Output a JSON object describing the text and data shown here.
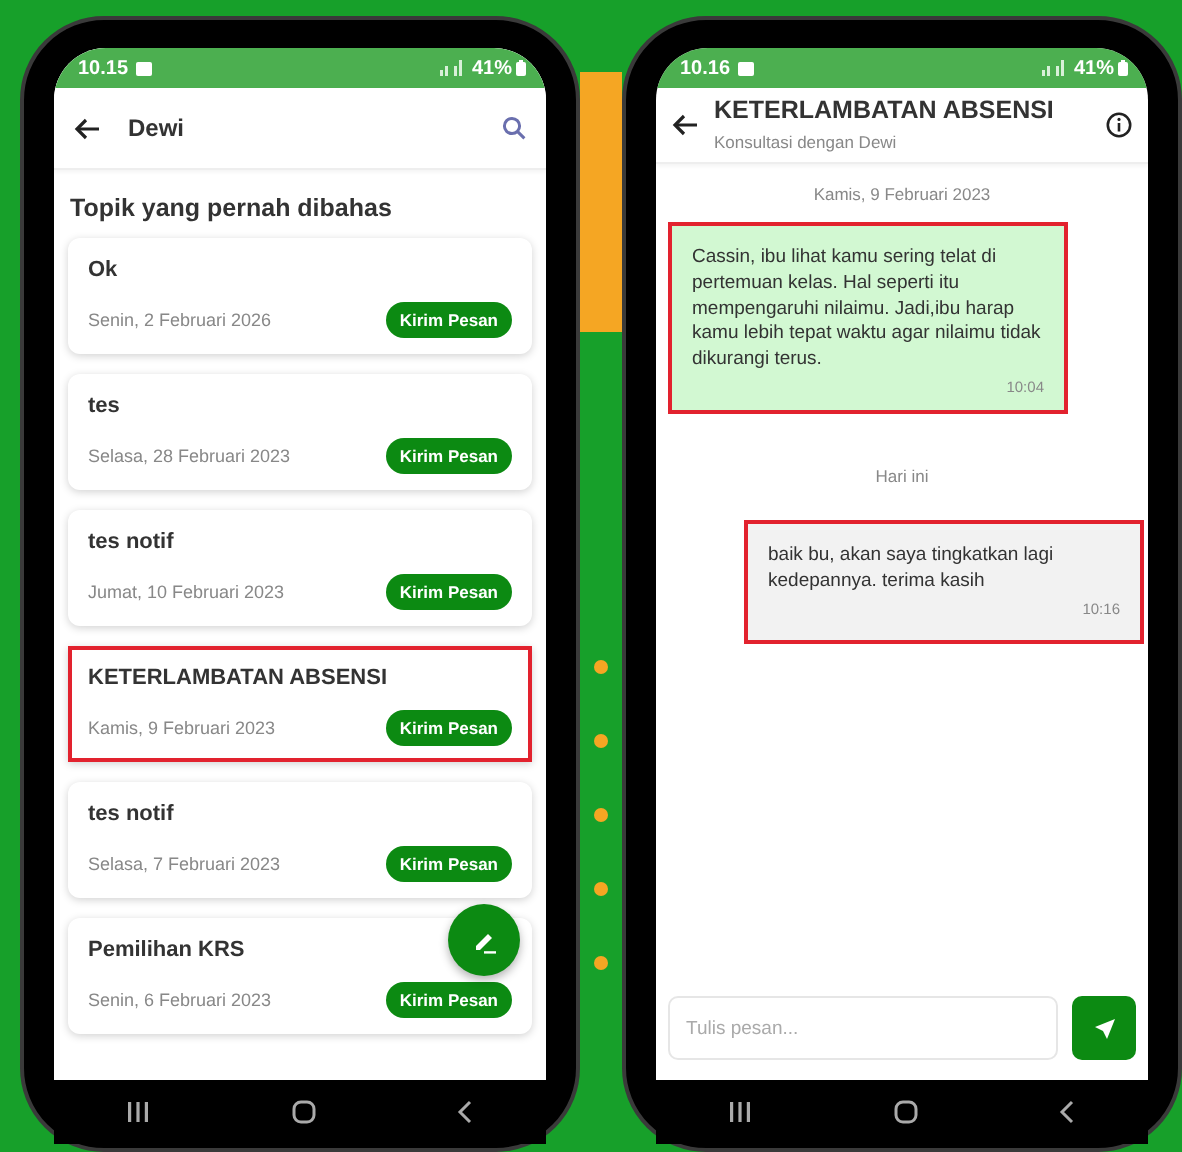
{
  "left_screen": {
    "status_bar": {
      "time": "10.15",
      "battery": "41%"
    },
    "app_bar": {
      "title": "Dewi"
    },
    "heading": "Topik yang pernah dibahas",
    "topics": [
      {
        "title": "Ok",
        "date": "Senin, 2 Februari 2026",
        "button": "Kirim Pesan",
        "highlighted": false
      },
      {
        "title": "tes",
        "date": "Selasa, 28 Februari 2023",
        "button": "Kirim Pesan",
        "highlighted": false
      },
      {
        "title": "tes notif",
        "date": "Jumat, 10 Februari 2023",
        "button": "Kirim Pesan",
        "highlighted": false
      },
      {
        "title": "KETERLAMBATAN ABSENSI",
        "date": "Kamis, 9 Februari 2023",
        "button": "Kirim Pesan",
        "highlighted": true
      },
      {
        "title": "tes notif",
        "date": "Selasa, 7 Februari 2023",
        "button": "Kirim Pesan",
        "highlighted": false
      },
      {
        "title": "Pemilihan KRS",
        "date": "Senin, 6 Februari 2023",
        "button": "Kirim Pesan",
        "highlighted": false
      }
    ]
  },
  "right_screen": {
    "status_bar": {
      "time": "10.16",
      "battery": "41%"
    },
    "header": {
      "title": "KETERLAMBATAN ABSENSI",
      "subtitle": "Konsultasi dengan Dewi"
    },
    "messages": [
      {
        "kind": "date",
        "text": "Kamis, 9 Februari 2023"
      },
      {
        "kind": "received",
        "text": "Cassin, ibu lihat kamu sering telat di pertemuan kelas. Hal seperti itu mempengaruhi nilaimu. Jadi,ibu harap kamu lebih tepat waktu agar nilaimu tidak dikurangi terus.",
        "time": "10:04",
        "highlighted": true
      },
      {
        "kind": "date",
        "text": "Hari ini"
      },
      {
        "kind": "sent",
        "text": "baik bu, akan saya tingkatkan lagi kedepannya. terima kasih",
        "time": "10:16",
        "highlighted": true
      }
    ],
    "composer": {
      "placeholder": "Tulis pesan..."
    }
  }
}
